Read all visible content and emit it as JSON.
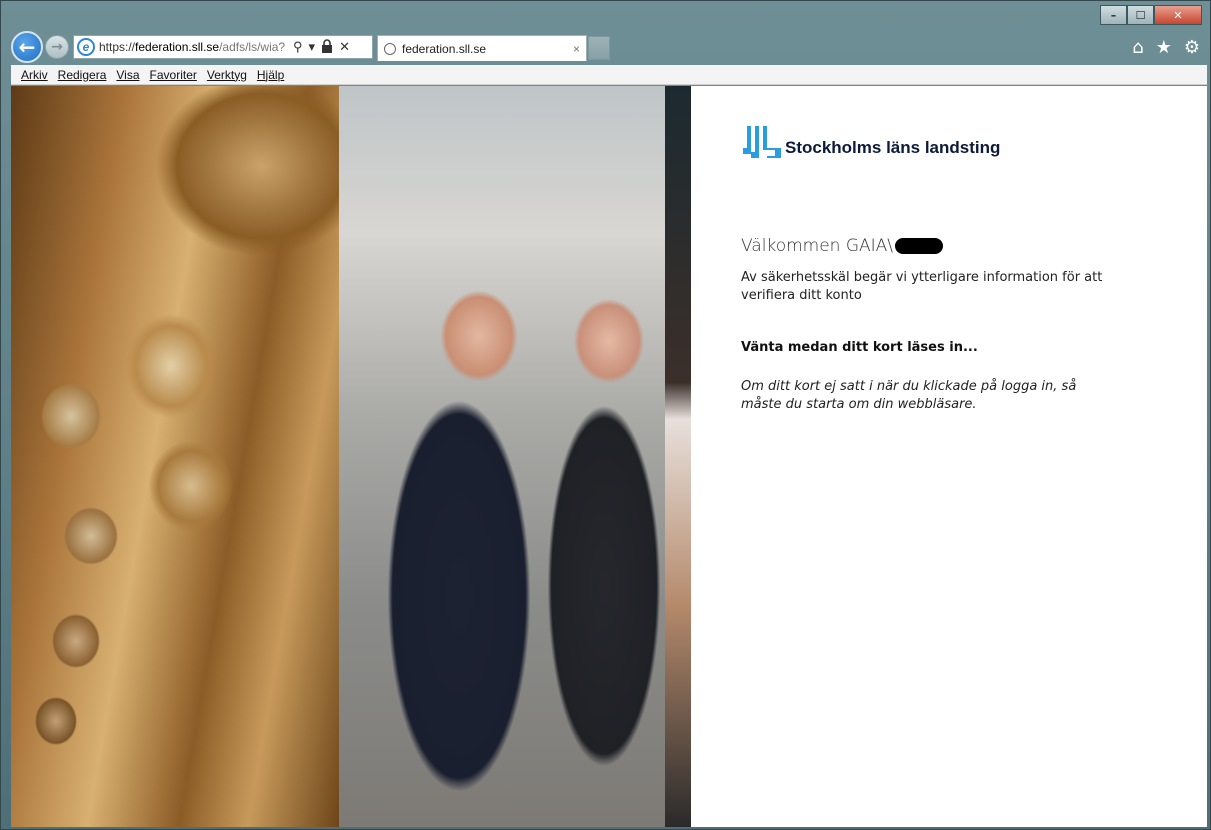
{
  "window": {
    "controls": {
      "minimize": "–",
      "maximize": "☐",
      "close": "✕"
    }
  },
  "nav": {
    "back_icon": "←",
    "forward_icon": "→",
    "address": {
      "scheme": "https://",
      "domain": "federation.sll.se",
      "path": "/adfs/ls/wia?",
      "icons": {
        "search": "⚲",
        "dropdown": "▾",
        "lock": "🔒",
        "stop": "✕"
      }
    },
    "tab": {
      "title": "federation.sll.se",
      "close": "×"
    },
    "right_icons": {
      "home": "⌂",
      "favorites": "★",
      "settings": "⚙"
    }
  },
  "menubar": {
    "items": [
      "Arkiv",
      "Redigera",
      "Visa",
      "Favoriter",
      "Verktyg",
      "Hjälp"
    ]
  },
  "login": {
    "logo_text": "Stockholms läns landsting",
    "welcome": "Välkommen GAIA\\",
    "info": "Av säkerhetsskäl begär vi ytterligare information för att verifiera ditt konto",
    "waiting": "Vänta medan ditt kort läses in...",
    "note": "Om ditt kort ej satt i när du klickade på logga in, så måste du starta om din webbläsare."
  },
  "colors": {
    "logo_blue": "#2a9de0",
    "logo_text": "#0d1a3a",
    "ie_blue": "#2f86d6"
  }
}
